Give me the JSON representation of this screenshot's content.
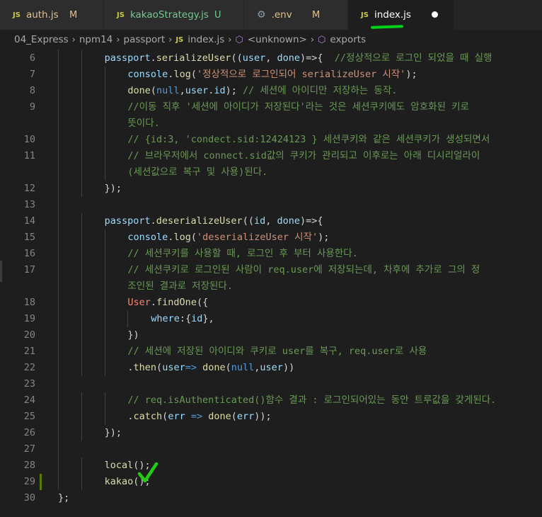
{
  "tabs": [
    {
      "icon": "JS",
      "name": "auth.js",
      "badge": "M",
      "state": "modified"
    },
    {
      "icon": "JS",
      "name": "kakaoStrategy.js",
      "badge": "U",
      "state": "untracked"
    },
    {
      "icon": "gear",
      "name": ".env",
      "badge": "M",
      "state": "modified"
    },
    {
      "icon": "JS",
      "name": "index.js",
      "badge": "",
      "state": "active-unsaved"
    }
  ],
  "breadcrumb": {
    "parts": [
      "04_Express",
      "npm14",
      "passport",
      "index.js",
      "<unknown>",
      "exports"
    ]
  },
  "editor": {
    "lines": [
      {
        "n": "6",
        "tokens": [
          [
            "kw",
            "passport"
          ],
          [
            "pun",
            "."
          ],
          [
            "fn",
            "serializeUser"
          ],
          [
            "pun",
            "(("
          ],
          [
            "kw",
            "user"
          ],
          [
            "pun",
            ", "
          ],
          [
            "kw",
            "done"
          ],
          [
            "pun",
            ")=>{  "
          ],
          [
            "cmt",
            "//정상적으로 로그인 되었을 때 실행"
          ]
        ]
      },
      {
        "n": "7",
        "tokens": [
          [
            "kw",
            "console"
          ],
          [
            "pun",
            "."
          ],
          [
            "fn",
            "log"
          ],
          [
            "pun",
            "("
          ],
          [
            "str",
            "'정상적으로 로그인되어 serializeUser 시작'"
          ],
          [
            "pun",
            ");"
          ]
        ]
      },
      {
        "n": "8",
        "tokens": [
          [
            "fn",
            "done"
          ],
          [
            "pun",
            "("
          ],
          [
            "lit",
            "null"
          ],
          [
            "pun",
            ","
          ],
          [
            "kw",
            "user"
          ],
          [
            "pun",
            "."
          ],
          [
            "kw",
            "id"
          ],
          [
            "pun",
            "); "
          ],
          [
            "cmt",
            "// 세션에 아이디만 저장하는 동작."
          ]
        ]
      },
      {
        "n": "9",
        "tokens": [
          [
            "cmt",
            "//이동 직후 '세션에 아이디가 저장된다'라는 것은 세션쿠키에도 암호화된 키로"
          ]
        ]
      },
      {
        "n": "",
        "tokens": [
          [
            "cmt",
            "뜻이다."
          ]
        ]
      },
      {
        "n": "10",
        "tokens": [
          [
            "cmt",
            "// {id:3, 'condect.sid:12424123 } 세션쿠키와 같은 세션쿠키가 생성되면서"
          ]
        ]
      },
      {
        "n": "11",
        "tokens": [
          [
            "cmt",
            "// 브라우저에서 connect.sid값의 쿠키가 관리되고 이후로는 아래 디시리얼라이"
          ]
        ]
      },
      {
        "n": "",
        "tokens": [
          [
            "cmt",
            "(세션값으로 복구 및 사용)된다."
          ]
        ]
      },
      {
        "n": "12",
        "tokens": [
          [
            "pun",
            "});"
          ]
        ]
      },
      {
        "n": "13",
        "tokens": []
      },
      {
        "n": "14",
        "tokens": [
          [
            "kw",
            "passport"
          ],
          [
            "pun",
            "."
          ],
          [
            "fn",
            "deserializeUser"
          ],
          [
            "pun",
            "(("
          ],
          [
            "kw",
            "id"
          ],
          [
            "pun",
            ", "
          ],
          [
            "kw",
            "done"
          ],
          [
            "pun",
            ")=>{"
          ]
        ]
      },
      {
        "n": "15",
        "tokens": [
          [
            "kw",
            "console"
          ],
          [
            "pun",
            "."
          ],
          [
            "fn",
            "log"
          ],
          [
            "pun",
            "("
          ],
          [
            "str",
            "'deserializeUser 시작'"
          ],
          [
            "pun",
            ");"
          ]
        ]
      },
      {
        "n": "16",
        "tokens": [
          [
            "cmt",
            "// 세션쿠키를 사용할 때, 로그인 후 부터 사용한다."
          ]
        ]
      },
      {
        "n": "17",
        "tokens": [
          [
            "cmt",
            "// 세션쿠키로 로그인된 사람이 req.user에 저장되는데, 차후에 추가로 그의 정"
          ]
        ]
      },
      {
        "n": "",
        "tokens": [
          [
            "cmt",
            "조인된 결과로 저장된다."
          ]
        ]
      },
      {
        "n": "18",
        "tokens": [
          [
            "err",
            "User"
          ],
          [
            "pun",
            "."
          ],
          [
            "fn",
            "findOne"
          ],
          [
            "pun",
            "({"
          ]
        ]
      },
      {
        "n": "19",
        "tokens": [
          [
            "kw",
            "where"
          ],
          [
            "pun",
            ":{"
          ],
          [
            "kw",
            "id"
          ],
          [
            "pun",
            "},"
          ]
        ]
      },
      {
        "n": "20",
        "tokens": [
          [
            "pun",
            "})"
          ]
        ]
      },
      {
        "n": "21",
        "tokens": [
          [
            "cmt",
            "// 세션에 저장된 아이디와 쿠키로 user를 복구, req.user로 사용"
          ]
        ]
      },
      {
        "n": "22",
        "tokens": [
          [
            "pun",
            "."
          ],
          [
            "fn",
            "then"
          ],
          [
            "pun",
            "("
          ],
          [
            "kw",
            "user"
          ],
          [
            "lit",
            "=>"
          ],
          [
            "pun",
            " "
          ],
          [
            "fn",
            "done"
          ],
          [
            "pun",
            "("
          ],
          [
            "lit",
            "null"
          ],
          [
            "pun",
            ","
          ],
          [
            "kw",
            "user"
          ],
          [
            "pun",
            "))"
          ]
        ]
      },
      {
        "n": "23",
        "tokens": []
      },
      {
        "n": "24",
        "tokens": [
          [
            "cmt",
            "// req.isAuthenticated()함수 결과 : 로그인되어있는 동안 트루값을 갖게된다."
          ]
        ]
      },
      {
        "n": "25",
        "tokens": [
          [
            "pun",
            "."
          ],
          [
            "fn",
            "catch"
          ],
          [
            "pun",
            "("
          ],
          [
            "kw",
            "err"
          ],
          [
            "pun",
            " "
          ],
          [
            "lit",
            "=>"
          ],
          [
            "pun",
            " "
          ],
          [
            "fn",
            "done"
          ],
          [
            "pun",
            "("
          ],
          [
            "kw",
            "err"
          ],
          [
            "pun",
            "));"
          ]
        ]
      },
      {
        "n": "26",
        "tokens": [
          [
            "pun",
            "});"
          ]
        ]
      },
      {
        "n": "27",
        "tokens": []
      },
      {
        "n": "28",
        "tokens": [
          [
            "fn",
            "local"
          ],
          [
            "pun",
            "();"
          ]
        ]
      },
      {
        "n": "29",
        "tokens": [
          [
            "fn",
            "kakao"
          ],
          [
            "pun",
            "();"
          ]
        ]
      },
      {
        "n": "30",
        "tokens": [
          [
            "pun",
            "};"
          ]
        ]
      }
    ],
    "indents": [
      2,
      3,
      3,
      3,
      3,
      3,
      3,
      3,
      2,
      0,
      2,
      3,
      3,
      3,
      3,
      3,
      4,
      3,
      3,
      3,
      0,
      3,
      3,
      2,
      0,
      2,
      2,
      0
    ]
  },
  "colors": {
    "accent_underline": "#00d21a",
    "checkmark": "#22cc11",
    "modified": "#e2c08d",
    "untracked": "#73c991"
  }
}
